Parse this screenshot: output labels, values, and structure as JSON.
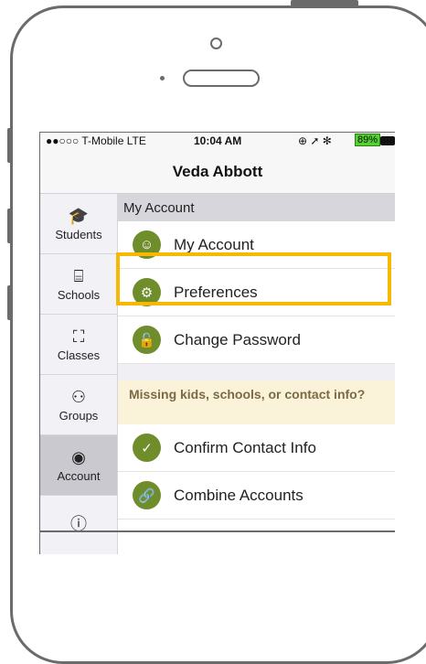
{
  "status_bar": {
    "carrier": "●●○○○ T-Mobile  LTE",
    "time": "10:04 AM",
    "icons": "⊕ ➚ ✻",
    "battery": "89%"
  },
  "nav": {
    "title": "Veda Abbott"
  },
  "sidebar": {
    "items": [
      {
        "label": "Students",
        "icon": "graduation-cap-icon",
        "glyph": "🎓"
      },
      {
        "label": "Schools",
        "icon": "school-board-icon",
        "glyph": "⌸"
      },
      {
        "label": "Classes",
        "icon": "classroom-icon",
        "glyph": "⛶"
      },
      {
        "label": "Groups",
        "icon": "people-group-icon",
        "glyph": "⚇"
      },
      {
        "label": "Account",
        "icon": "user-circle-icon",
        "glyph": "◉"
      },
      {
        "label": "",
        "icon": "info-icon",
        "glyph": "ⓘ"
      }
    ],
    "active": "Account"
  },
  "main": {
    "section_title": "My Account",
    "rows": [
      {
        "label": "My Account",
        "glyph": "☺"
      },
      {
        "label": "Preferences",
        "glyph": "⚙"
      },
      {
        "label": "Change Password",
        "glyph": "🔓"
      }
    ],
    "notice": "Missing kids, schools, or contact info?",
    "rows2": [
      {
        "label": "Confirm Contact Info",
        "glyph": "✓"
      },
      {
        "label": "Combine Accounts",
        "glyph": "🔗"
      }
    ]
  },
  "colors": {
    "accent": "#6f8d2a",
    "highlight": "#f6b800",
    "notice_bg": "#fbf3d9"
  }
}
